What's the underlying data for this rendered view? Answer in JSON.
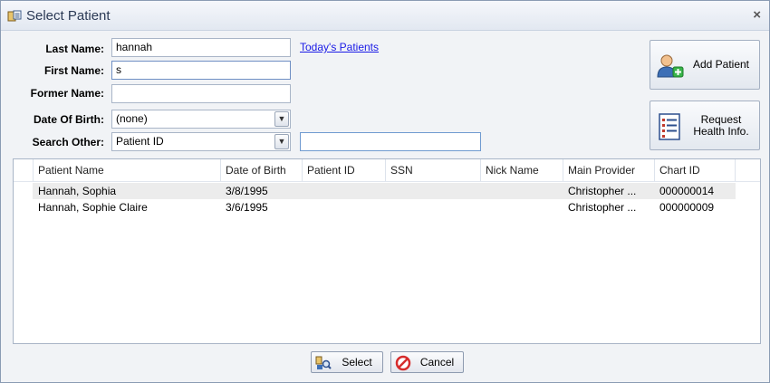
{
  "window": {
    "title": "Select Patient",
    "close_glyph": "×"
  },
  "form": {
    "last_name": {
      "label": "Last Name:",
      "value": "hannah"
    },
    "first_name": {
      "label": "First Name:",
      "value": "s"
    },
    "former_name": {
      "label": "Former Name:",
      "value": ""
    },
    "date_of_birth": {
      "label": "Date Of Birth:",
      "value": "(none)"
    },
    "search_other": {
      "label": "Search Other:",
      "value": "Patient ID",
      "text_value": ""
    },
    "todays_patients_link": "Today's Patients"
  },
  "buttons": {
    "add_patient": {
      "label": "Add Patient",
      "icon": "add-user-icon"
    },
    "request_health": {
      "line1": "Request",
      "line2": "Health Info.",
      "icon": "list-icon"
    },
    "select": {
      "label": "Select",
      "icon": "search-patient-icon"
    },
    "cancel": {
      "label": "Cancel",
      "icon": "cancel-icon"
    }
  },
  "table": {
    "columns": [
      "Patient Name",
      "Date of Birth",
      "Patient ID",
      "SSN",
      "Nick Name",
      "Main Provider",
      "Chart ID"
    ],
    "rows": [
      {
        "name": "Hannah, Sophia",
        "dob": "3/8/1995",
        "patient_id": "",
        "ssn": "",
        "nick": "",
        "provider": "Christopher ...",
        "chart_id": "000000014",
        "selected": true
      },
      {
        "name": "Hannah, Sophie Claire",
        "dob": "3/6/1995",
        "patient_id": "",
        "ssn": "",
        "nick": "",
        "provider": "Christopher ...",
        "chart_id": "000000009",
        "selected": false
      }
    ]
  },
  "colors": {
    "link": "#1a1ae6",
    "selected_row": "#ececec",
    "title_text": "#2b3a55"
  }
}
